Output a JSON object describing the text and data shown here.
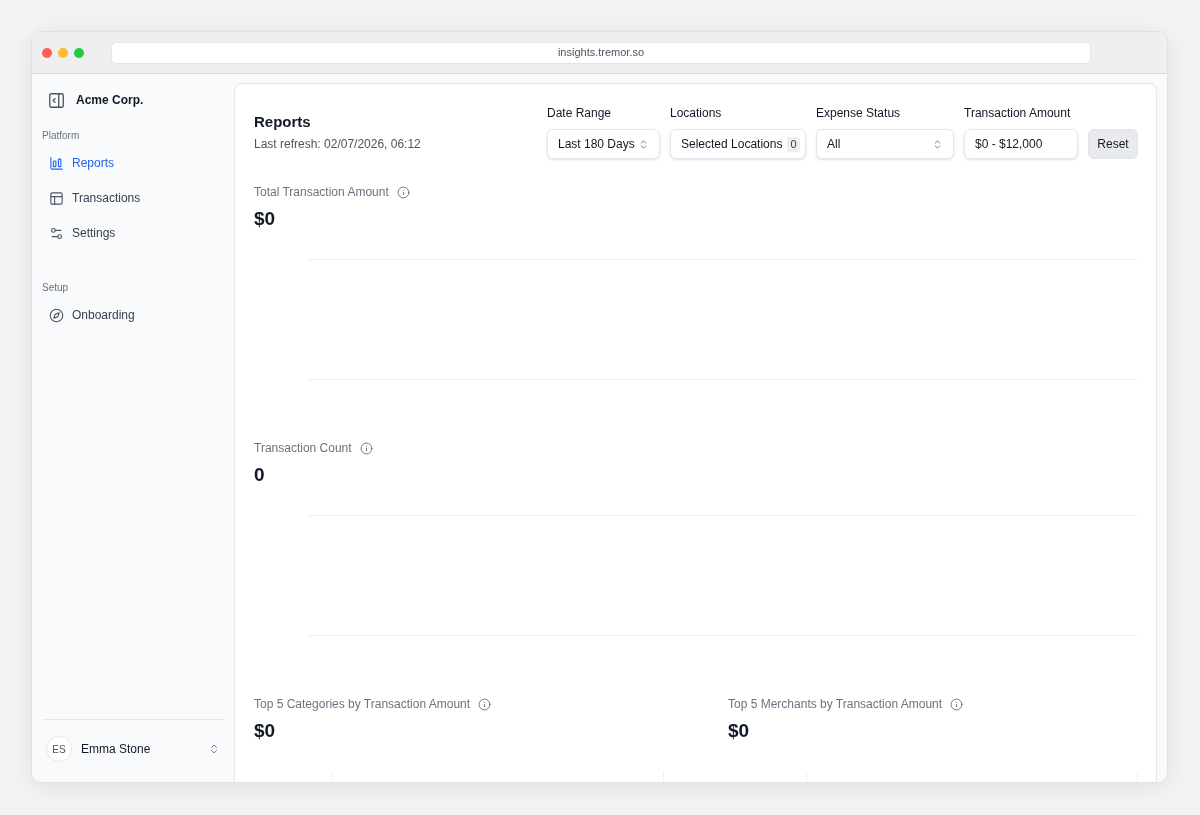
{
  "browser": {
    "url": "insights.tremor.so"
  },
  "sidebar": {
    "company": "Acme Corp.",
    "sections": [
      {
        "label": "Platform",
        "items": [
          {
            "label": "Reports",
            "selected": true
          },
          {
            "label": "Transactions",
            "selected": false
          },
          {
            "label": "Settings",
            "selected": false
          }
        ]
      },
      {
        "label": "Setup",
        "items": [
          {
            "label": "Onboarding",
            "selected": false
          }
        ]
      }
    ],
    "user": {
      "initials": "ES",
      "name": "Emma Stone"
    }
  },
  "header": {
    "title": "Reports",
    "last_refresh": "Last refresh: 02/07/2026, 06:12"
  },
  "filters": [
    {
      "kind": "select",
      "label": "Date Range",
      "value": "Last 180 Days"
    },
    {
      "kind": "multiselect",
      "label": "Locations",
      "value": "Selected Locations",
      "count": "0"
    },
    {
      "kind": "select",
      "label": "Expense Status",
      "value": "All"
    },
    {
      "kind": "input",
      "label": "Transaction Amount",
      "value": "$0 - $12,000"
    }
  ],
  "reset_button": "Reset",
  "metrics": [
    {
      "title": "Total Transaction Amount",
      "value": "$0"
    },
    {
      "title": "Transaction Count",
      "value": "0"
    }
  ],
  "top_charts": [
    {
      "title": "Top 5 Categories by Transaction Amount",
      "value": "$0"
    },
    {
      "title": "Top 5 Merchants by Transaction Amount",
      "value": "$0"
    }
  ]
}
